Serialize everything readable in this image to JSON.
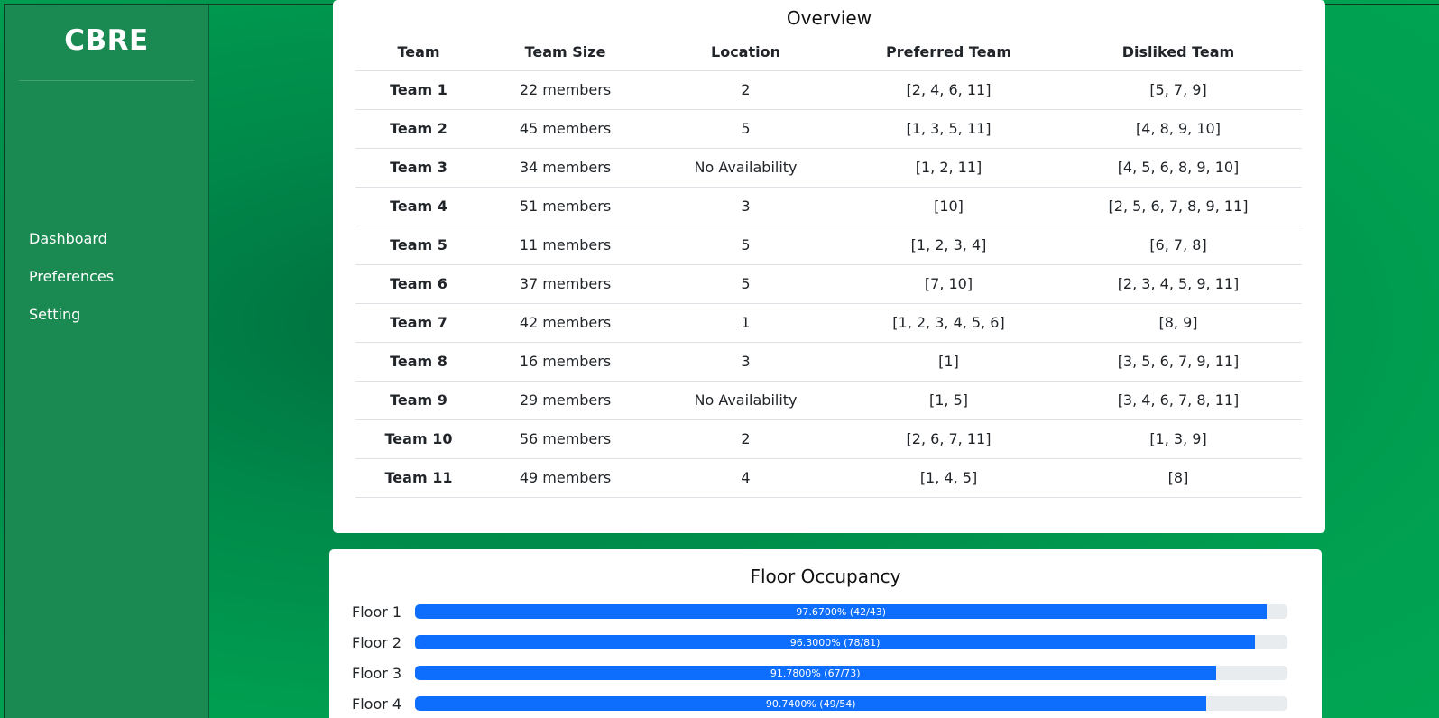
{
  "brand": "CBRE",
  "nav": [
    {
      "label": "Dashboard"
    },
    {
      "label": "Preferences"
    },
    {
      "label": "Setting"
    }
  ],
  "overview": {
    "title": "Overview",
    "columns": [
      "Team",
      "Team Size",
      "Location",
      "Preferred Team",
      "Disliked Team"
    ],
    "rows": [
      [
        "Team 1",
        "22 members",
        "2",
        "[2, 4, 6, 11]",
        "[5, 7, 9]"
      ],
      [
        "Team 2",
        "45 members",
        "5",
        "[1, 3, 5, 11]",
        "[4, 8, 9, 10]"
      ],
      [
        "Team 3",
        "34 members",
        "No Availability",
        "[1, 2, 11]",
        "[4, 5, 6, 8, 9, 10]"
      ],
      [
        "Team 4",
        "51 members",
        "3",
        "[10]",
        "[2, 5, 6, 7, 8, 9, 11]"
      ],
      [
        "Team 5",
        "11 members",
        "5",
        "[1, 2, 3, 4]",
        "[6, 7, 8]"
      ],
      [
        "Team 6",
        "37 members",
        "5",
        "[7, 10]",
        "[2, 3, 4, 5, 9, 11]"
      ],
      [
        "Team 7",
        "42 members",
        "1",
        "[1, 2, 3, 4, 5, 6]",
        "[8, 9]"
      ],
      [
        "Team 8",
        "16 members",
        "3",
        "[1]",
        "[3, 5, 6, 7, 9, 11]"
      ],
      [
        "Team 9",
        "29 members",
        "No Availability",
        "[1, 5]",
        "[3, 4, 6, 7, 8, 11]"
      ],
      [
        "Team 10",
        "56 members",
        "2",
        "[2, 6, 7, 11]",
        "[1, 3, 9]"
      ],
      [
        "Team 11",
        "49 members",
        "4",
        "[1, 4, 5]",
        "[8]"
      ]
    ]
  },
  "occupancy": {
    "title": "Floor Occupancy",
    "floors": [
      {
        "label": "Floor 1",
        "percent": 97.67,
        "text": "97.6700% (42/43)"
      },
      {
        "label": "Floor 2",
        "percent": 96.3,
        "text": "96.3000% (78/81)"
      },
      {
        "label": "Floor 3",
        "percent": 91.78,
        "text": "91.7800% (67/73)"
      },
      {
        "label": "Floor 4",
        "percent": 90.74,
        "text": "90.7400% (49/54)"
      }
    ]
  },
  "colors": {
    "sidebar": "#1b8a52",
    "progress": "#0d6efd",
    "progress_track": "#e9ecef"
  }
}
